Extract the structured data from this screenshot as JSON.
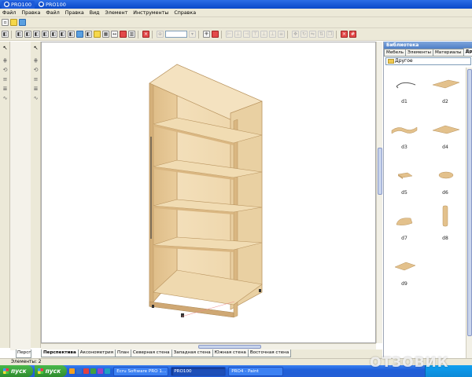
{
  "titlebar": {
    "tabs": [
      {
        "label": "PRO100",
        "active": true
      },
      {
        "label": "PRO100",
        "active": false
      }
    ]
  },
  "menu": {
    "items": [
      "Файл",
      "Правка",
      "Файл",
      "Правка",
      "Вид",
      "Элемент",
      "Инструменты",
      "Справка"
    ]
  },
  "toolbar": {
    "zoom_value": ""
  },
  "view_tabs": {
    "left_tab": "Персп",
    "tabs": [
      "Перспектива",
      "Аксонометрия",
      "План",
      "Северная стена",
      "Западная стена",
      "Южная стена",
      "Восточная стена"
    ],
    "active": "Перспектива"
  },
  "status": {
    "text": "Элементы: 2"
  },
  "library": {
    "title": "Библиотека",
    "tabs": [
      "Мебель",
      "Элементы",
      "Материалы",
      "Другое"
    ],
    "active_tab": "Другое",
    "category": "Другое",
    "items": [
      {
        "label": "d1",
        "icon": "curve-shape-icon"
      },
      {
        "label": "d2",
        "icon": "panel-shape-icon"
      },
      {
        "label": "d3",
        "icon": "wave-panel-icon"
      },
      {
        "label": "d4",
        "icon": "diamond-panel-icon"
      },
      {
        "label": "d5",
        "icon": "slab-icon"
      },
      {
        "label": "d6",
        "icon": "round-slab-icon"
      },
      {
        "label": "d7",
        "icon": "half-round-slab-icon"
      },
      {
        "label": "d8",
        "icon": "column-icon"
      },
      {
        "label": "d9",
        "icon": "flat-panel-icon"
      }
    ]
  },
  "taskbar": {
    "start_label": "пуск",
    "tasks": [
      {
        "label": "Ecru Software PRO 1...",
        "active": false
      },
      {
        "label": "PRO100",
        "active": true
      },
      {
        "label": "PRO4 - Paint",
        "active": false
      }
    ]
  },
  "watermark": {
    "text": "ОТЗОВИК"
  },
  "colors": {
    "wood_light": "#f0dab2",
    "wood_mid": "#e6c895",
    "wood_dark": "#d1ae78",
    "xp_blue": "#225ed5",
    "panel_bg": "#ece9d8"
  }
}
